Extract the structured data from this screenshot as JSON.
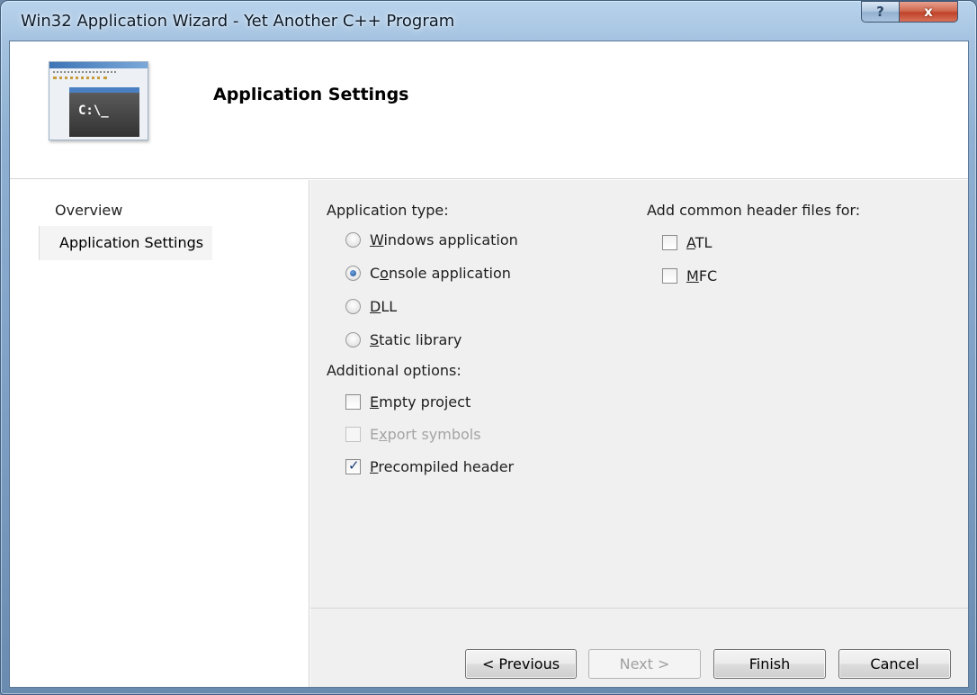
{
  "window": {
    "title": "Win32 Application Wizard - Yet Another C++ Program",
    "help_label": "?",
    "close_label": "x"
  },
  "header": {
    "title": "Application Settings",
    "icon_text": "C:\\_"
  },
  "sidebar": {
    "items": [
      {
        "label": "Overview",
        "selected": false
      },
      {
        "label": "Application Settings",
        "selected": true
      }
    ]
  },
  "application_type": {
    "label": "Application type:",
    "options": [
      {
        "key": "W",
        "rest": "indows application",
        "checked": false
      },
      {
        "key": "o",
        "pre": "C",
        "rest": "nsole application",
        "checked": true
      },
      {
        "key": "D",
        "rest": "LL",
        "checked": false
      },
      {
        "key": "S",
        "rest": "tatic library",
        "checked": false
      }
    ]
  },
  "additional_options": {
    "label": "Additional options:",
    "options": [
      {
        "key": "E",
        "rest": "mpty project",
        "checked": false,
        "enabled": true
      },
      {
        "key": "x",
        "pre": "E",
        "rest": "port symbols",
        "checked": false,
        "enabled": false
      },
      {
        "key": "P",
        "rest": "recompiled header",
        "checked": true,
        "enabled": true
      }
    ]
  },
  "common_headers": {
    "label": "Add common header files for:",
    "options": [
      {
        "key": "A",
        "rest": "TL",
        "checked": false
      },
      {
        "key": "M",
        "rest": "FC",
        "checked": false
      }
    ]
  },
  "buttons": {
    "previous": "< Previous",
    "next": "Next >",
    "finish": "Finish",
    "cancel": "Cancel"
  }
}
